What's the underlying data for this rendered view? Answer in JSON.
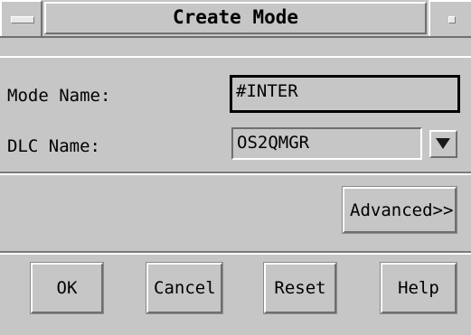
{
  "window": {
    "title": "Create Mode"
  },
  "form": {
    "mode_name_label": "Mode Name:",
    "mode_name_value": "#INTER",
    "dlc_name_label": "DLC Name:",
    "dlc_name_value": "OS2QMGR"
  },
  "buttons": {
    "advanced": "Advanced>>",
    "ok": "OK",
    "cancel": "Cancel",
    "reset": "Reset",
    "help": "Help"
  },
  "icons": {
    "window_menu": "window-menu-icon",
    "minimize": "minimize-icon",
    "dropdown": "dropdown-arrow-icon"
  }
}
